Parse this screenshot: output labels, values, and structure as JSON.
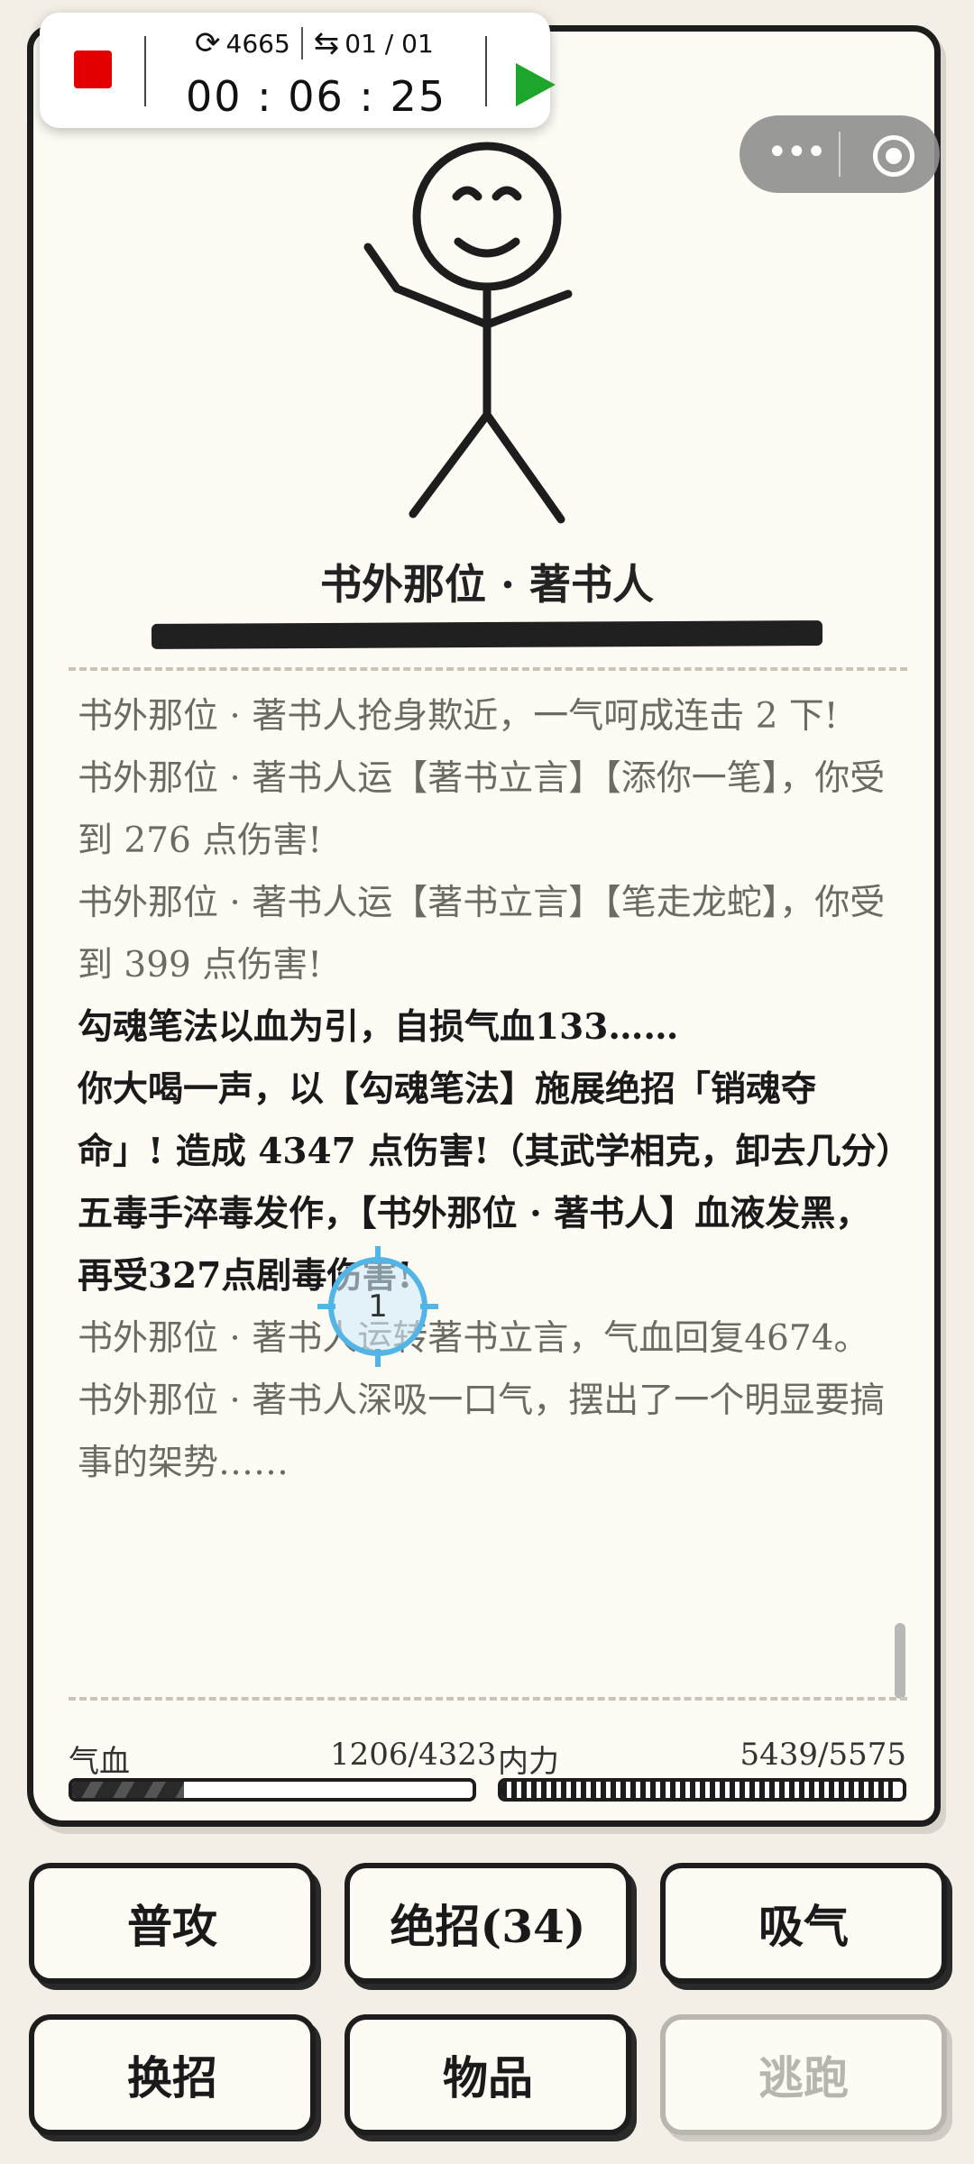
{
  "recorder": {
    "loop_count": "4665",
    "run_count": "01 / 01",
    "timer": "00 : 06 : 25"
  },
  "enemy": {
    "name": "书外那位 · 著书人"
  },
  "log": [
    {
      "text": "书外那位 · 著书人抢身欺近，一气呵成连击 2 下!",
      "style": "normal"
    },
    {
      "text": "书外那位 · 著书人运【著书立言】【添你一笔】，你受到 276 点伤害!",
      "style": "normal"
    },
    {
      "text": "书外那位 · 著书人运【著书立言】【笔走龙蛇】，你受到 399 点伤害!",
      "style": "normal"
    },
    {
      "text": "勾魂笔法以血为引，自损气血133……",
      "style": "strong"
    },
    {
      "text": "你大喝一声，以【勾魂笔法】施展绝招「销魂夺命」! 造成 4347 点伤害!（其武学相克，卸去几分）",
      "style": "strong"
    },
    {
      "text": "五毒手淬毒发作，【书外那位 · 著书人】血液发黑，再受327点剧毒伤害!",
      "style": "strong"
    },
    {
      "text": "书外那位 · 著书人运转著书立言，气血回复4674。",
      "style": "normal"
    },
    {
      "text": "书外那位 · 著书人深吸一口气，摆出了一个明显要搞事的架势……",
      "style": "normal"
    }
  ],
  "stats": {
    "hp": {
      "label": "气血",
      "value": "1206/4323",
      "fraction": 0.279
    },
    "mp": {
      "label": "内力",
      "value": "5439/5575",
      "fraction": 0.976
    }
  },
  "buttons": {
    "attack": "普攻",
    "ultimate": "绝招(34)",
    "breathe": "吸气",
    "switch": "换招",
    "items": "物品",
    "flee": "逃跑"
  },
  "touch": {
    "label": "1"
  }
}
